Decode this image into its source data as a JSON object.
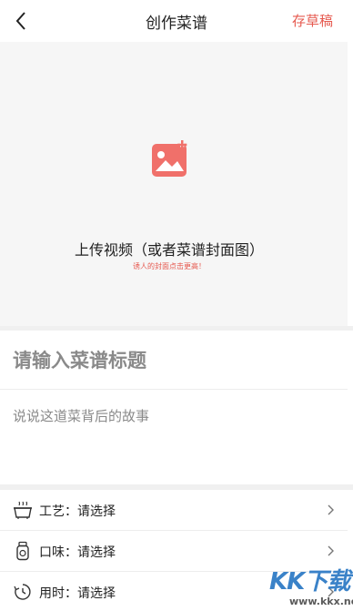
{
  "nav": {
    "title": "创作菜谱",
    "draft_label": "存草稿"
  },
  "cover": {
    "upload_label": "上传视频（或者菜谱封面图）",
    "hint": "诱人的封面点击更高！"
  },
  "form": {
    "title_placeholder": "请输入菜谱标题",
    "story_placeholder": "说说这道菜背后的故事"
  },
  "options": [
    {
      "label": "工艺：请选择",
      "icon": "cooking-pot-icon"
    },
    {
      "label": "口味：请选择",
      "icon": "seasoning-jar-icon"
    },
    {
      "label": "用时：请选择",
      "icon": "timer-icon"
    }
  ],
  "watermark": {
    "logo_text": "KK下载",
    "url": "www.kkx.net"
  },
  "colors": {
    "accent": "#e6594f",
    "icon_red": "#f0706a",
    "background_gray": "#f6f6f6",
    "watermark_blue": "#3a82c8"
  }
}
